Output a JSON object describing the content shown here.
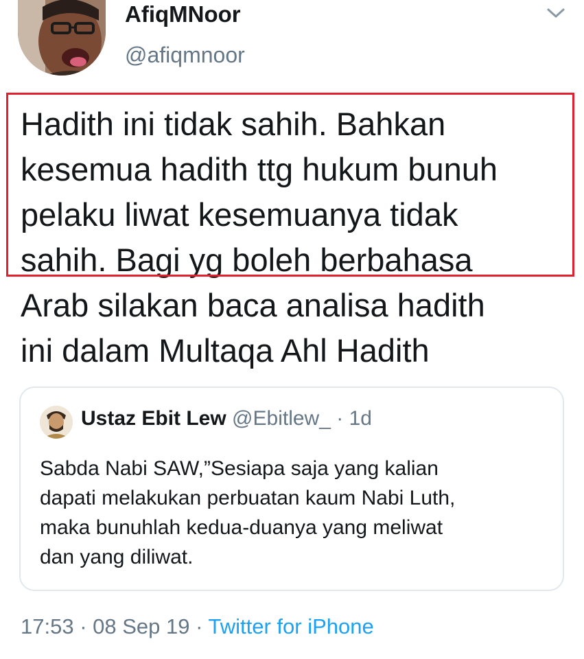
{
  "author": {
    "display_name": "AfiqMNoor",
    "handle": "@afiqmnoor"
  },
  "icons": {
    "menu": "chevron-down-icon"
  },
  "tweet": {
    "lines": [
      "Hadith ini tidak sahih. Bahkan",
      "kesemua hadith ttg hukum bunuh",
      "pelaku liwat kesemuanya tidak",
      "sahih. Bagi yg boleh berbahasa",
      "Arab silakan baca analisa hadith",
      "ini dalam Multaqa Ahl Hadith"
    ]
  },
  "quoted_tweet": {
    "display_name": "Ustaz Ebit Lew",
    "handle": "@Ebitlew_",
    "separator": " · ",
    "time": "1d",
    "lines": [
      "Sabda Nabi SAW,”Sesiapa saja yang kalian",
      "dapati melakukan perbuatan kaum Nabi Luth,",
      "maka bunuhlah kedua-duanya yang meliwat",
      "dan yang diliwat."
    ]
  },
  "meta": {
    "time": "17:53",
    "separator1": " · ",
    "date": "08 Sep 19",
    "separator2": " · ",
    "source": "Twitter for iPhone"
  },
  "colors": {
    "highlight_border": "#e0202e",
    "link": "#1da1f2",
    "secondary_text": "#657786",
    "card_border": "#e1e8ed"
  }
}
